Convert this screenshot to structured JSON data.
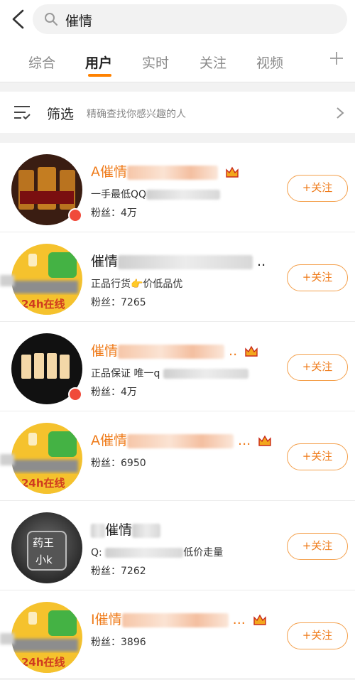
{
  "search": {
    "query": "催情"
  },
  "tabs": [
    "综合",
    "用户",
    "实时",
    "关注",
    "视频"
  ],
  "filter": {
    "title": "筛选",
    "subtitle": "精确查找你感兴趣的人"
  },
  "users": [
    {
      "name": "A催情",
      "desc": "一手最低QQ",
      "fans": "粉丝：4万",
      "follow": "+关注"
    },
    {
      "name": "催情",
      "desc": "正品行货👉价低品优",
      "fans": "粉丝：7265",
      "follow": "+关注",
      "online": "24h在线"
    },
    {
      "name": "催情",
      "desc": "正品保证 唯一q",
      "fans": "粉丝：4万",
      "follow": "+关注"
    },
    {
      "name": "A催情",
      "desc": "",
      "fans": "粉丝：6950",
      "follow": "+关注",
      "online": "24h在线"
    },
    {
      "name": "催情",
      "desc_prefix": "Q:",
      "desc_suffix": "低价走量",
      "fans": "粉丝：7262",
      "follow": "+关注",
      "avatar_text": [
        "药王",
        "小k"
      ]
    },
    {
      "name": "I催情",
      "desc": "",
      "fans": "粉丝：3896",
      "follow": "+关注",
      "online": "24h在线"
    }
  ],
  "colors": {
    "accent": "#ff8200",
    "name_orange": "#ef7b1a",
    "background": "#f2f2f2"
  },
  "icons": [
    "back-arrow-icon",
    "search-icon",
    "plus-icon",
    "filter-icon",
    "chevron-right-icon",
    "crown-icon",
    "verified-badge-icon"
  ]
}
